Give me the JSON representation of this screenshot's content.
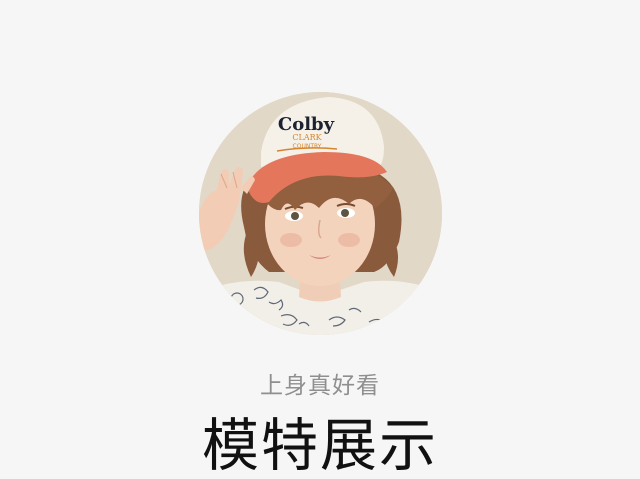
{
  "avatar": {
    "cap_text_line1": "Colby",
    "cap_text_line2": "CLARK",
    "cap_text_line3": "COUNTRY"
  },
  "subtitle": "上身真好看",
  "title": "模特展示",
  "colors": {
    "background": "#f6f6f6",
    "subtitle": "#8f8f8f",
    "title": "#111111",
    "cap_brim": "#e4775b",
    "cap_crown": "#f5f1e8"
  }
}
